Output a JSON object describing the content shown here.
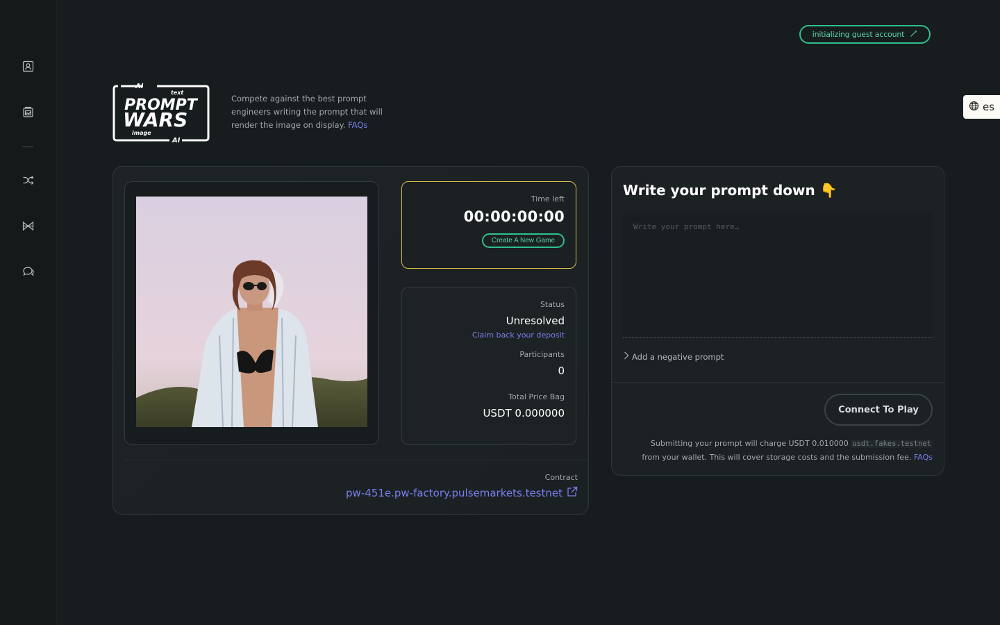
{
  "header": {
    "guest_status": "initializing guest account",
    "language": "es"
  },
  "sidebar": {
    "items": [
      {
        "icon": "contact-card-icon"
      },
      {
        "icon": "photo-gallery-icon"
      },
      {
        "icon": "shuffle-icon"
      },
      {
        "icon": "bowtie-icon"
      },
      {
        "icon": "chat-bubbles-icon"
      }
    ]
  },
  "brand": {
    "logo_text": {
      "top": "AI",
      "small": "text",
      "line1": "PROMPT",
      "line2": "WARS",
      "sub": "image",
      "bottom": "AI"
    },
    "intro_text": "Compete against the best prompt engineers writing the prompt that will render the image on display.",
    "intro_link": "FAQs"
  },
  "game": {
    "timer": {
      "label": "Time left",
      "value": "00:00:00:00",
      "button": "Create A New Game"
    },
    "status": {
      "label": "Status",
      "value": "Unresolved",
      "claim_link": "Claim back your deposit",
      "participants_label": "Participants",
      "participants_value": "0",
      "price_label": "Total Price Bag",
      "price_value": "USDT 0.000000"
    },
    "contract": {
      "label": "Contract",
      "value": "pw-451e.pw-factory.pulsemarkets.testnet"
    }
  },
  "prompt": {
    "title": "Write your prompt down 👇",
    "placeholder": "Write your prompt here…",
    "negative_prompt": "Add a negative prompt",
    "connect_button": "Connect To Play",
    "fee_text_1": "Submitting your prompt will charge USDT 0.010000",
    "fee_token": "usdt.fakes.testnet",
    "fee_text_2": "from your wallet. This will cover storage costs and the submission fee.",
    "fee_link": "FAQs"
  },
  "colors": {
    "accent_green": "#2fbf8f",
    "accent_yellow": "#d9c04a",
    "link_purple": "#7c7ef0",
    "background": "#171c1e"
  }
}
